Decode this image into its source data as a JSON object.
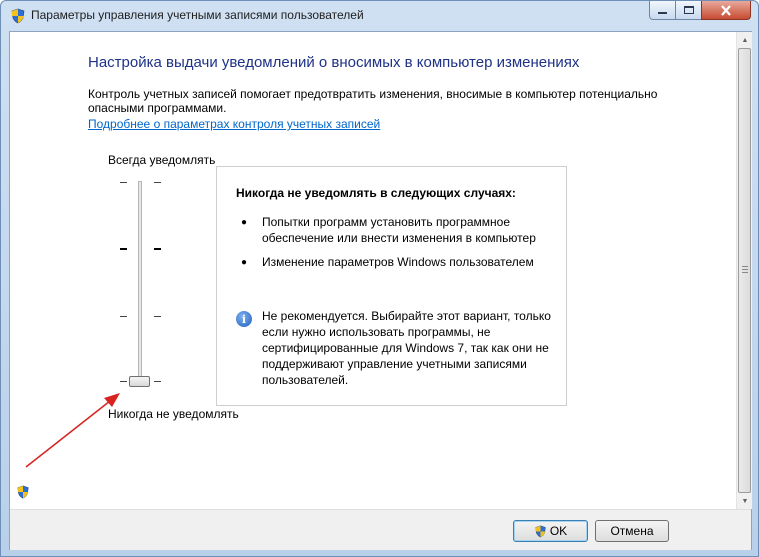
{
  "window": {
    "title": "Параметры управления учетными записями пользователей",
    "icon": "uac-shield-icon"
  },
  "main": {
    "heading": "Настройка выдачи уведомлений о вносимых в компьютер изменениях",
    "description": "Контроль учетных записей помогает предотвратить изменения, вносимые в компьютер потенциально опасными программами.",
    "help_link": "Подробнее о параметрах контроля учетных записей"
  },
  "slider": {
    "top_label": "Всегда уведомлять",
    "bottom_label": "Никогда не уведомлять",
    "levels": 4,
    "selected_level": 1
  },
  "info": {
    "title": "Никогда не уведомлять в следующих случаях:",
    "items": [
      "Попытки программ установить программное обеспечение или внести изменения в компьютер",
      "Изменение параметров Windows пользователем"
    ],
    "warning": "Не рекомендуется. Выбирайте этот вариант, только если нужно использовать программы, не сертифицированные для Windows 7, так как они не поддерживают управление учетными записями пользователей."
  },
  "buttons": {
    "ok": "OK",
    "cancel": "Отмена"
  },
  "colors": {
    "heading": "#1e3287",
    "link": "#0066cc",
    "annotation_arrow": "#d8231e"
  }
}
